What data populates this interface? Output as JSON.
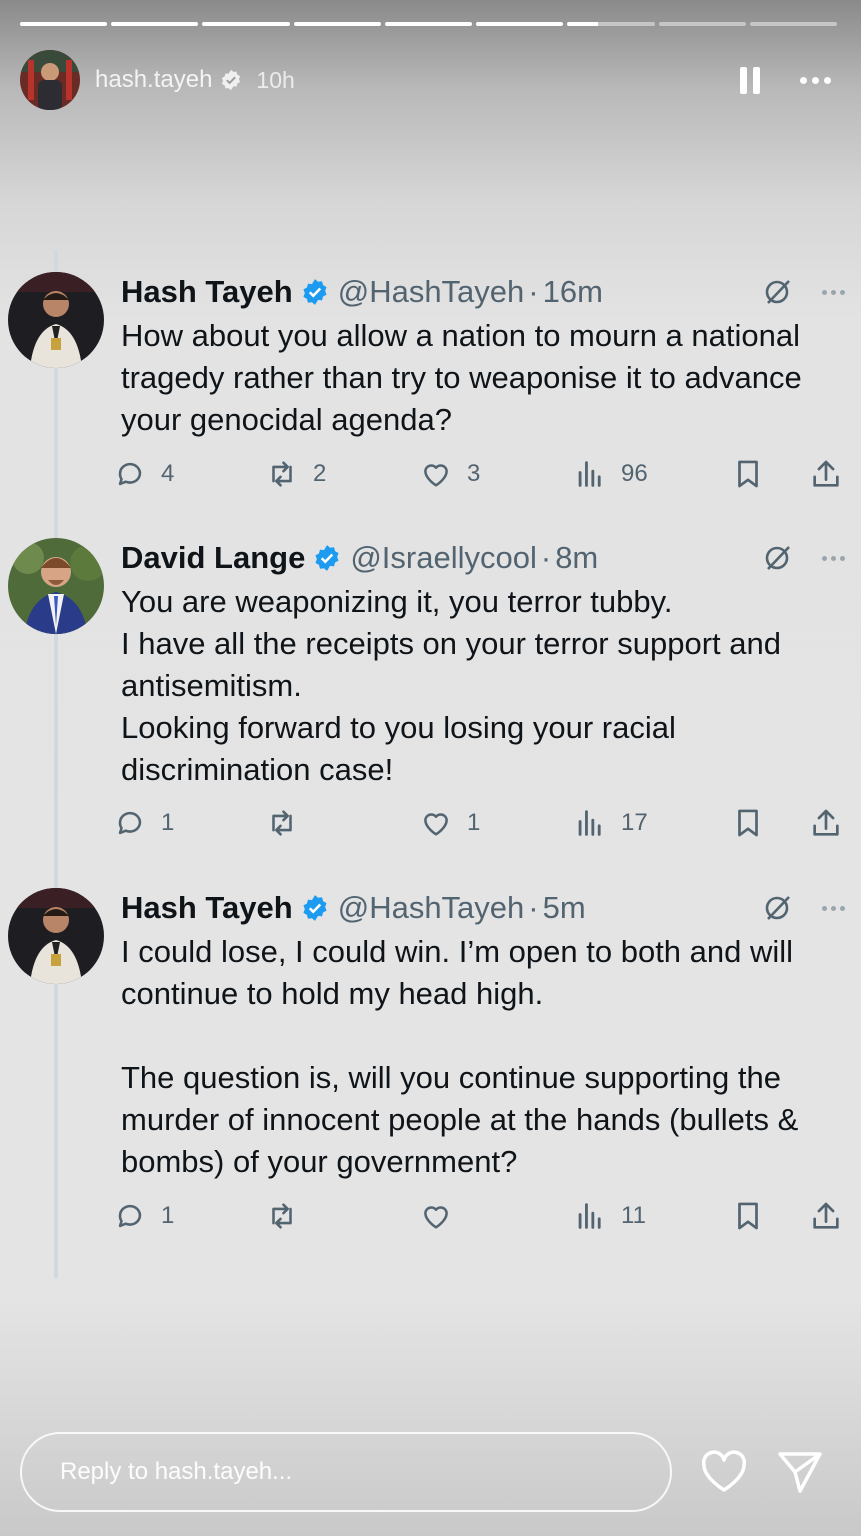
{
  "story": {
    "username": "hash.tayeh",
    "time": "10h",
    "progress_segments": [
      1,
      1,
      1,
      1,
      1,
      1,
      0.35,
      0,
      0
    ],
    "reply_placeholder": "Reply to hash.tayeh..."
  },
  "tweets": [
    {
      "name": "Hash Tayeh",
      "handle": "@HashTayeh",
      "dot": "·",
      "time": "16m",
      "text": "How about you allow a nation to mourn a national tragedy rather than try to weaponise it to advance your genocidal agenda?",
      "replies": "4",
      "retweets": "2",
      "likes": "3",
      "views": "96"
    },
    {
      "name": "David Lange",
      "handle": "@Israellycool",
      "dot": "·",
      "time": "8m",
      "text": "You are weaponizing it, you terror tubby.\nI have all the receipts on your terror support and antisemitism.\nLooking forward to you losing your racial discrimination case!",
      "replies": "1",
      "retweets": "",
      "likes": "1",
      "views": "17"
    },
    {
      "name": "Hash Tayeh",
      "handle": "@HashTayeh",
      "dot": "·",
      "time": "5m",
      "text": "I could lose, I could win. I’m open to both and will continue to hold my head high.\n\nThe question is, will you continue supporting the murder of innocent people at the hands (bullets & bombs) of your government?",
      "replies": "1",
      "retweets": "",
      "likes": "",
      "views": "11"
    }
  ],
  "colors": {
    "verified_blue": "#1d9bf0",
    "text_primary": "#0f1419",
    "text_secondary": "#536471"
  },
  "icons": [
    "pause-icon",
    "more-icon",
    "verified-icon",
    "grok-icon",
    "reply-icon",
    "retweet-icon",
    "like-icon",
    "views-icon",
    "bookmark-icon",
    "share-icon",
    "heart-icon",
    "send-icon"
  ]
}
